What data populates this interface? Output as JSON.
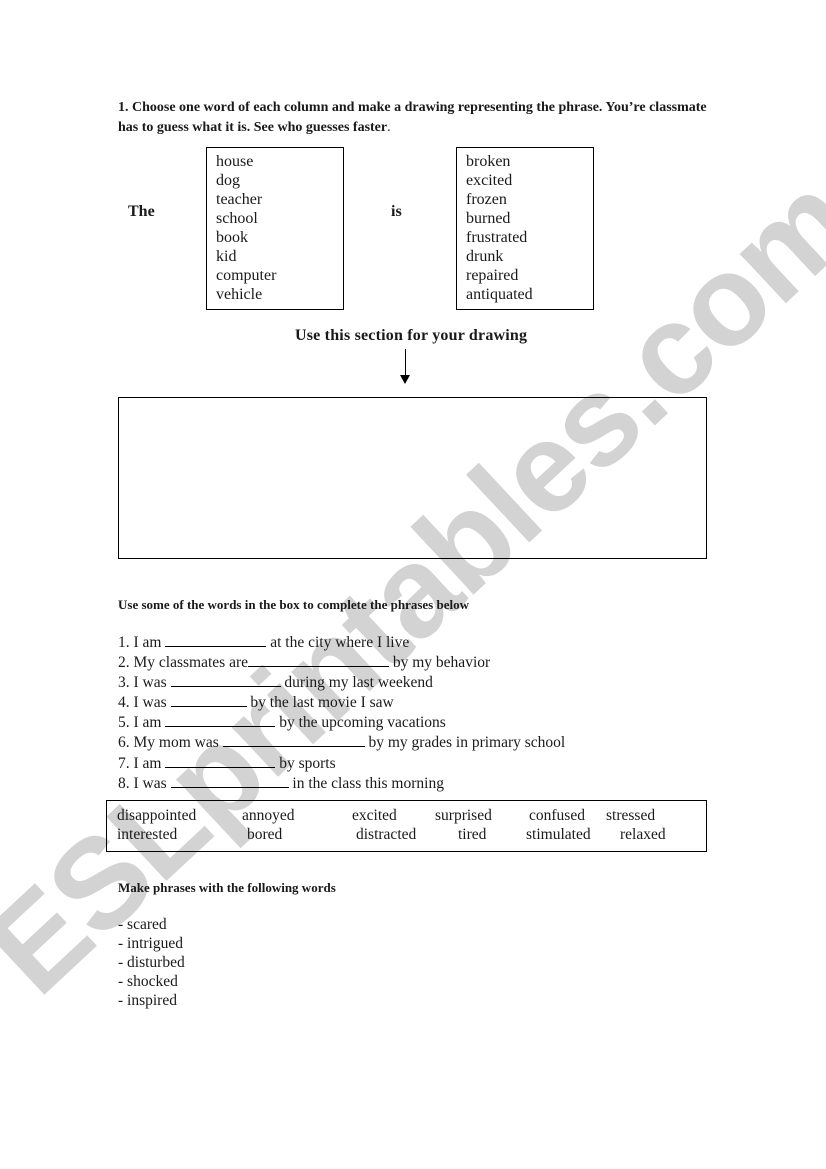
{
  "watermark": "ESLprintables.com",
  "section1": {
    "instruction_main": "1. Choose one word of each column and make a drawing representing the phrase. You’re classmate has to guess what it is. See who guesses faster",
    "instruction_end": ".",
    "the_label": "The",
    "is_label": "is",
    "nouns": [
      "house",
      "dog",
      "teacher",
      "school",
      "book",
      "kid",
      "computer",
      "vehicle"
    ],
    "adjectives": [
      "broken",
      "excited",
      "frozen",
      "burned",
      "frustrated",
      "drunk",
      "repaired",
      "antiquated"
    ],
    "drawing_label": "Use this section for your drawing"
  },
  "section2": {
    "instruction": "Use some of the words in the box to complete the phrases below",
    "phrases": [
      {
        "before": "1. I am ",
        "after": " at the city where I live"
      },
      {
        "before": "2. My classmates are",
        "after": " by my behavior"
      },
      {
        "before": "3. I was ",
        "after": " during my last weekend"
      },
      {
        "before": "4. I was ",
        "after": " by the last movie I saw"
      },
      {
        "before": "5. I am ",
        "after": " by the upcoming vacations"
      },
      {
        "before": "6. My mom was ",
        "after": " by my grades in primary school"
      },
      {
        "before": "7. I am ",
        "after": " by sports"
      },
      {
        "before": "8. I was ",
        "after": " in the class this morning"
      }
    ],
    "word_bank_row1": [
      "disappointed",
      "annoyed",
      "excited",
      "surprised",
      "confused",
      "stressed"
    ],
    "word_bank_row2": [
      "interested",
      "bored",
      "distracted",
      "tired",
      "stimulated",
      "relaxed"
    ]
  },
  "section3": {
    "instruction": "Make phrases with the following words",
    "words": [
      "- scared",
      "- intrigued",
      "- disturbed",
      "- shocked",
      "- inspired"
    ]
  }
}
